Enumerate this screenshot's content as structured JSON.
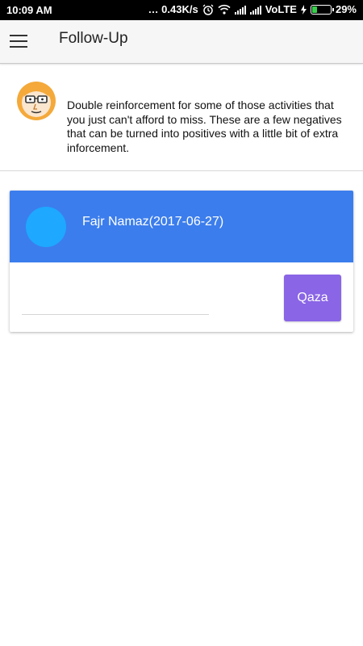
{
  "status_bar": {
    "time": "10:09 AM",
    "network_speed": "0.43K/s",
    "network_type": "VoLTE",
    "battery_percent": "29%",
    "battery_level": 0.29,
    "icons": [
      "alarm-icon",
      "wifi-icon",
      "signal-icon",
      "charging-icon",
      "battery-icon"
    ]
  },
  "app_bar": {
    "title": "Follow-Up",
    "menu_icon": "hamburger-menu-icon"
  },
  "intro": {
    "icon": "cartoon-face-icon",
    "text": "Double reinforcement for some of those activities that you just can't afford to miss. These are a few negatives that can be turned into positives with a little bit of extra inforcement."
  },
  "card": {
    "title": "Fajr Namaz(2017-06-27)",
    "input_value": "",
    "input_placeholder": "",
    "button_label": "Qaza"
  },
  "colors": {
    "card_header": "#3b7ded",
    "card_dot": "#1ea8ff",
    "qaza_button": "#8a65e6",
    "face": "#f4a93a"
  }
}
